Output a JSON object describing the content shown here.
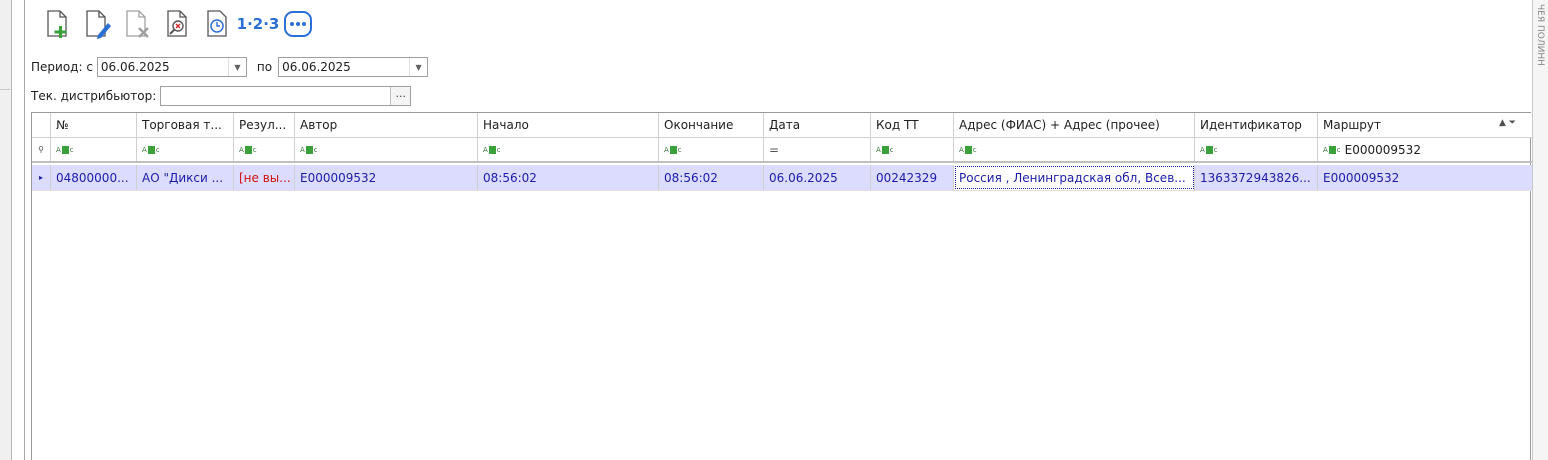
{
  "toolbar": {
    "buttons": [
      {
        "icon": "new-document-icon"
      },
      {
        "icon": "edit-document-icon"
      },
      {
        "icon": "delete-document-icon"
      },
      {
        "icon": "search-document-icon"
      },
      {
        "icon": "clock-icon"
      },
      {
        "icon": "numbering-icon",
        "label": "1·2·3"
      },
      {
        "icon": "more-icon"
      }
    ]
  },
  "filters": {
    "period_label": "Период: с",
    "date_from": "06.06.2025",
    "to_label": "по",
    "date_to": "06.06.2025",
    "distributor_label": "Тек. дистрибьютор:",
    "distributor_value": ""
  },
  "grid": {
    "columns": [
      "№",
      "Торговая т...",
      "Резул...",
      "Автор",
      "Начало",
      "Окончание",
      "Дата",
      "Код ТТ",
      "Адрес (ФИАС) + Адрес (прочее)",
      "Идентификатор",
      "Маршрут"
    ],
    "filter_marker": "abc",
    "date_filter_symbol": "=",
    "route_filter_value": "E000009532",
    "rows": [
      {
        "number": "04800000...",
        "trade_point": "АО \"Дикси ...",
        "result": "[не вы...",
        "author": "E000009532",
        "start": "08:56:02",
        "end": "08:56:02",
        "date": "06.06.2025",
        "tt_code": "00242329",
        "address": "Россия , Ленинградская обл, Всев...",
        "identifier": "1363372943826...",
        "route": "E000009532"
      }
    ]
  },
  "side_panel": {
    "text": "ЧЕЯ ПОЛИНН"
  },
  "colors": {
    "selected_row": "#dcdcff",
    "row_text": "#1c1ca8",
    "result_text": "#d01010",
    "accent": "#2a6fd6"
  }
}
